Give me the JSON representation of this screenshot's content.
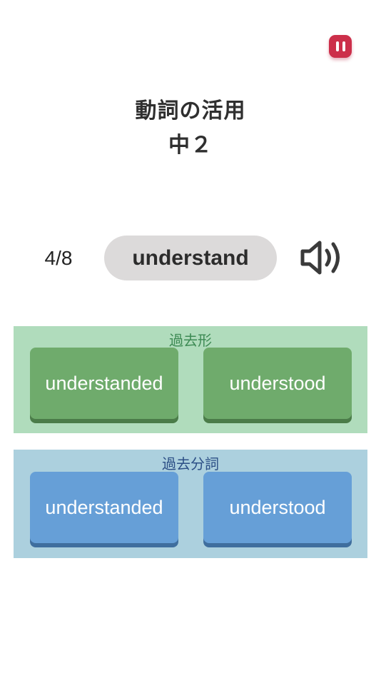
{
  "header": {
    "title": "動詞の活用",
    "grade": "中２",
    "pause_icon": "pause-icon",
    "pause_color": "#cc2f4a"
  },
  "question": {
    "progress": "4/8",
    "word": "understand",
    "speaker_icon": "speaker-icon"
  },
  "past_tense": {
    "label": "過去形",
    "color": "#6fab6c",
    "options": [
      "understanded",
      "understood"
    ]
  },
  "past_participle": {
    "label": "過去分詞",
    "color": "#669fd7",
    "options": [
      "understanded",
      "understood"
    ]
  }
}
